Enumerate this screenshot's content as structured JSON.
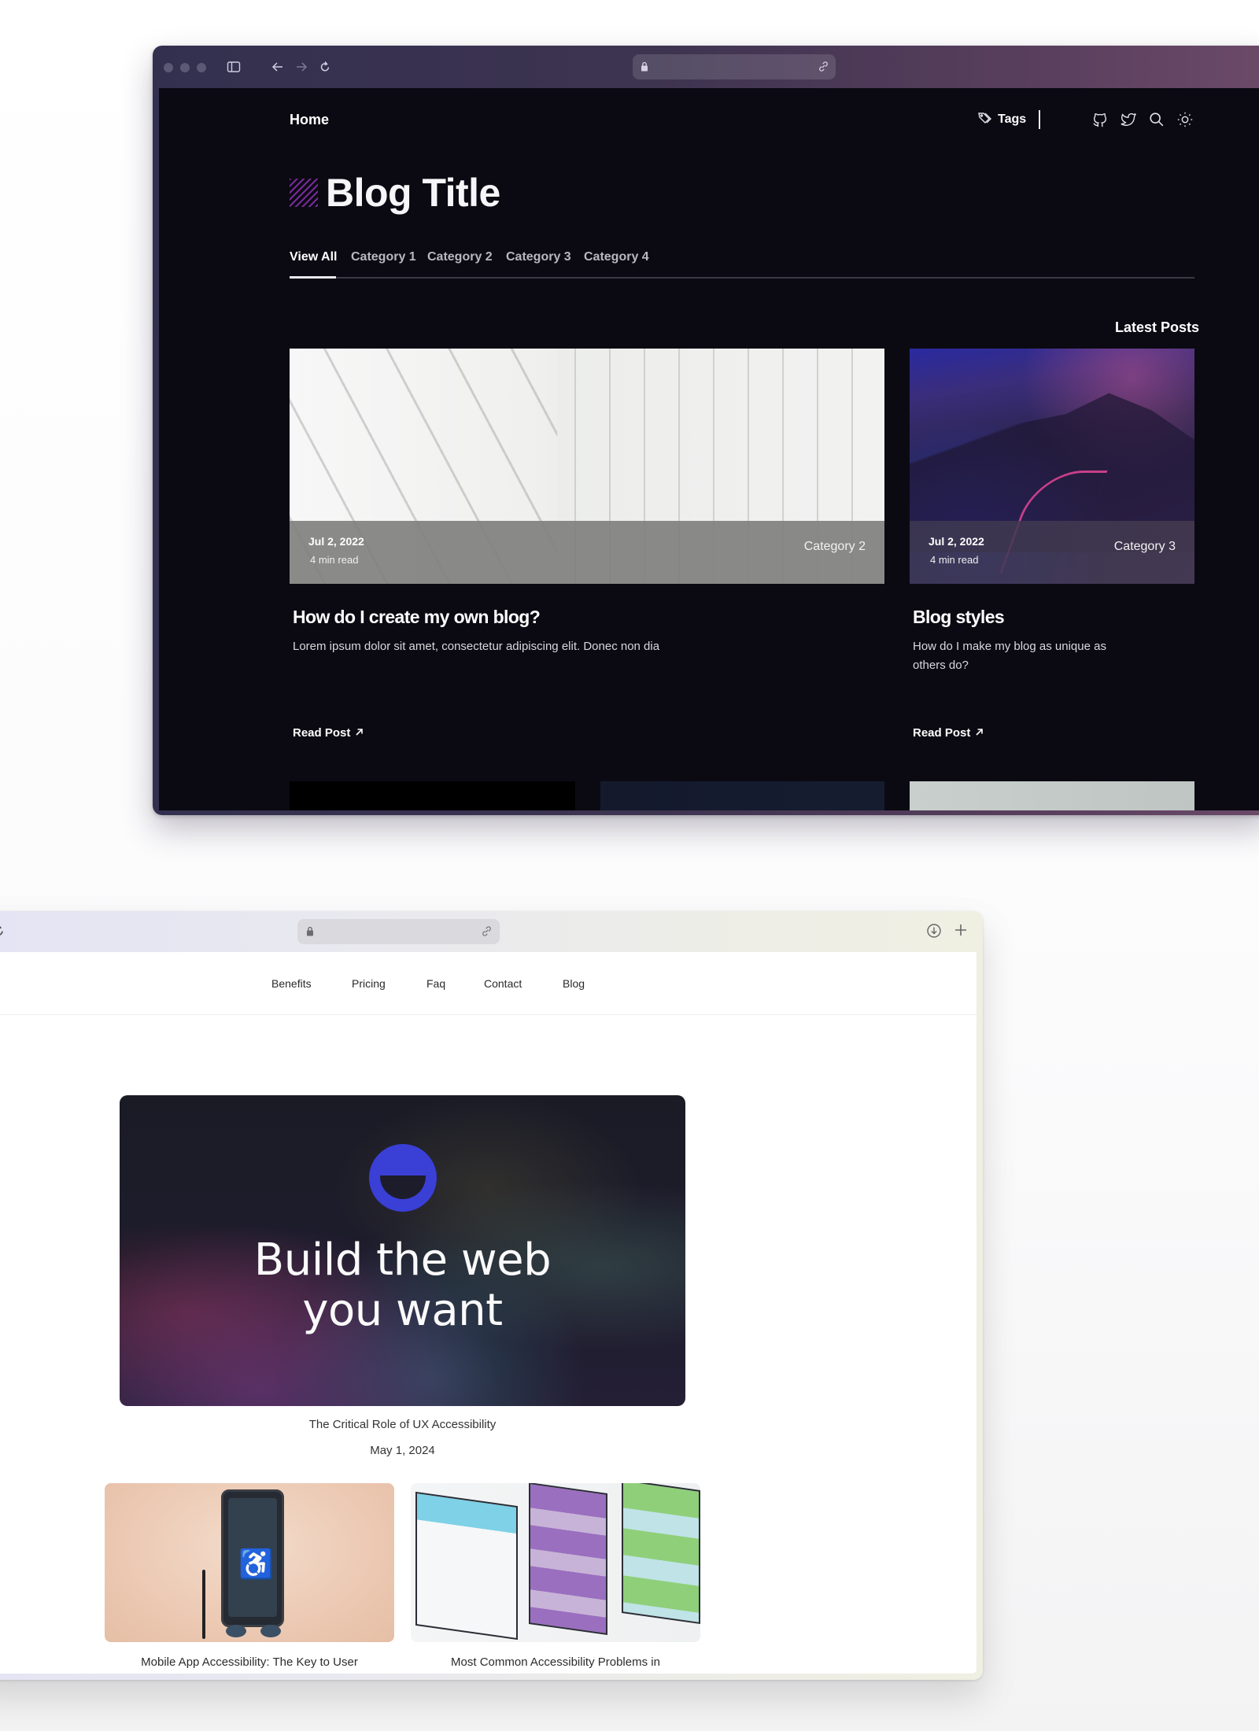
{
  "top_window": {
    "browser": {
      "traffic_lights": [
        "close",
        "minimize",
        "zoom"
      ],
      "icons": [
        "sidebar-icon",
        "back-icon",
        "forward-icon",
        "reload-icon"
      ],
      "address_bar": {
        "lock_icon": "lock-icon",
        "link_icon": "link-icon",
        "url": ""
      }
    },
    "header": {
      "home_label": "Home",
      "tags_label": "Tags",
      "icons": [
        "github-icon",
        "twitter-icon",
        "search-icon",
        "sun-icon"
      ]
    },
    "blog_title": "Blog Title",
    "tabs": [
      {
        "label": "View All",
        "active": true
      },
      {
        "label": "Category 1",
        "active": false
      },
      {
        "label": "Category 2",
        "active": false
      },
      {
        "label": "Category 3",
        "active": false
      },
      {
        "label": "Category 4",
        "active": false
      }
    ],
    "section_heading": "Latest Posts",
    "posts": [
      {
        "date": "Jul 2, 2022",
        "read_time": "4 min read",
        "category": "Category 2",
        "title": "How do I create my own blog?",
        "description": "Lorem ipsum dolor sit amet, consectetur adipiscing elit. Donec non dia",
        "cta": "Read Post",
        "image": "white-architecture-image"
      },
      {
        "date": "Jul 2, 2022",
        "read_time": "4 min read",
        "category": "Category 3",
        "title": "Blog styles",
        "description": "How do I make my blog as unique as others do?",
        "cta": "Read Post",
        "image": "night-mountain-image"
      }
    ],
    "colors": {
      "background": "#0b0a12",
      "text": "#ffffff",
      "accent": "#7b2c9e"
    }
  },
  "bottom_window": {
    "browser": {
      "address_bar": {
        "lock_icon": "lock-icon",
        "link_icon": "link-icon",
        "url": ""
      },
      "icons": [
        "reload-icon",
        "download-icon",
        "new-tab-icon"
      ]
    },
    "nav": [
      "Benefits",
      "Pricing",
      "Faq",
      "Contact",
      "Blog"
    ],
    "featured": {
      "hero_text_line1": "Build the web",
      "hero_text_line2": "you want",
      "title": "The Critical Role of UX Accessibility",
      "date": "May 1, 2024",
      "logo_color": "#3a3fd6"
    },
    "articles": [
      {
        "title": "Mobile App Accessibility: The Key to User",
        "image": "phone-accessibility-image"
      },
      {
        "title": "Most Common Accessibility Problems in",
        "image": "wireframe-sketch-image"
      }
    ]
  }
}
